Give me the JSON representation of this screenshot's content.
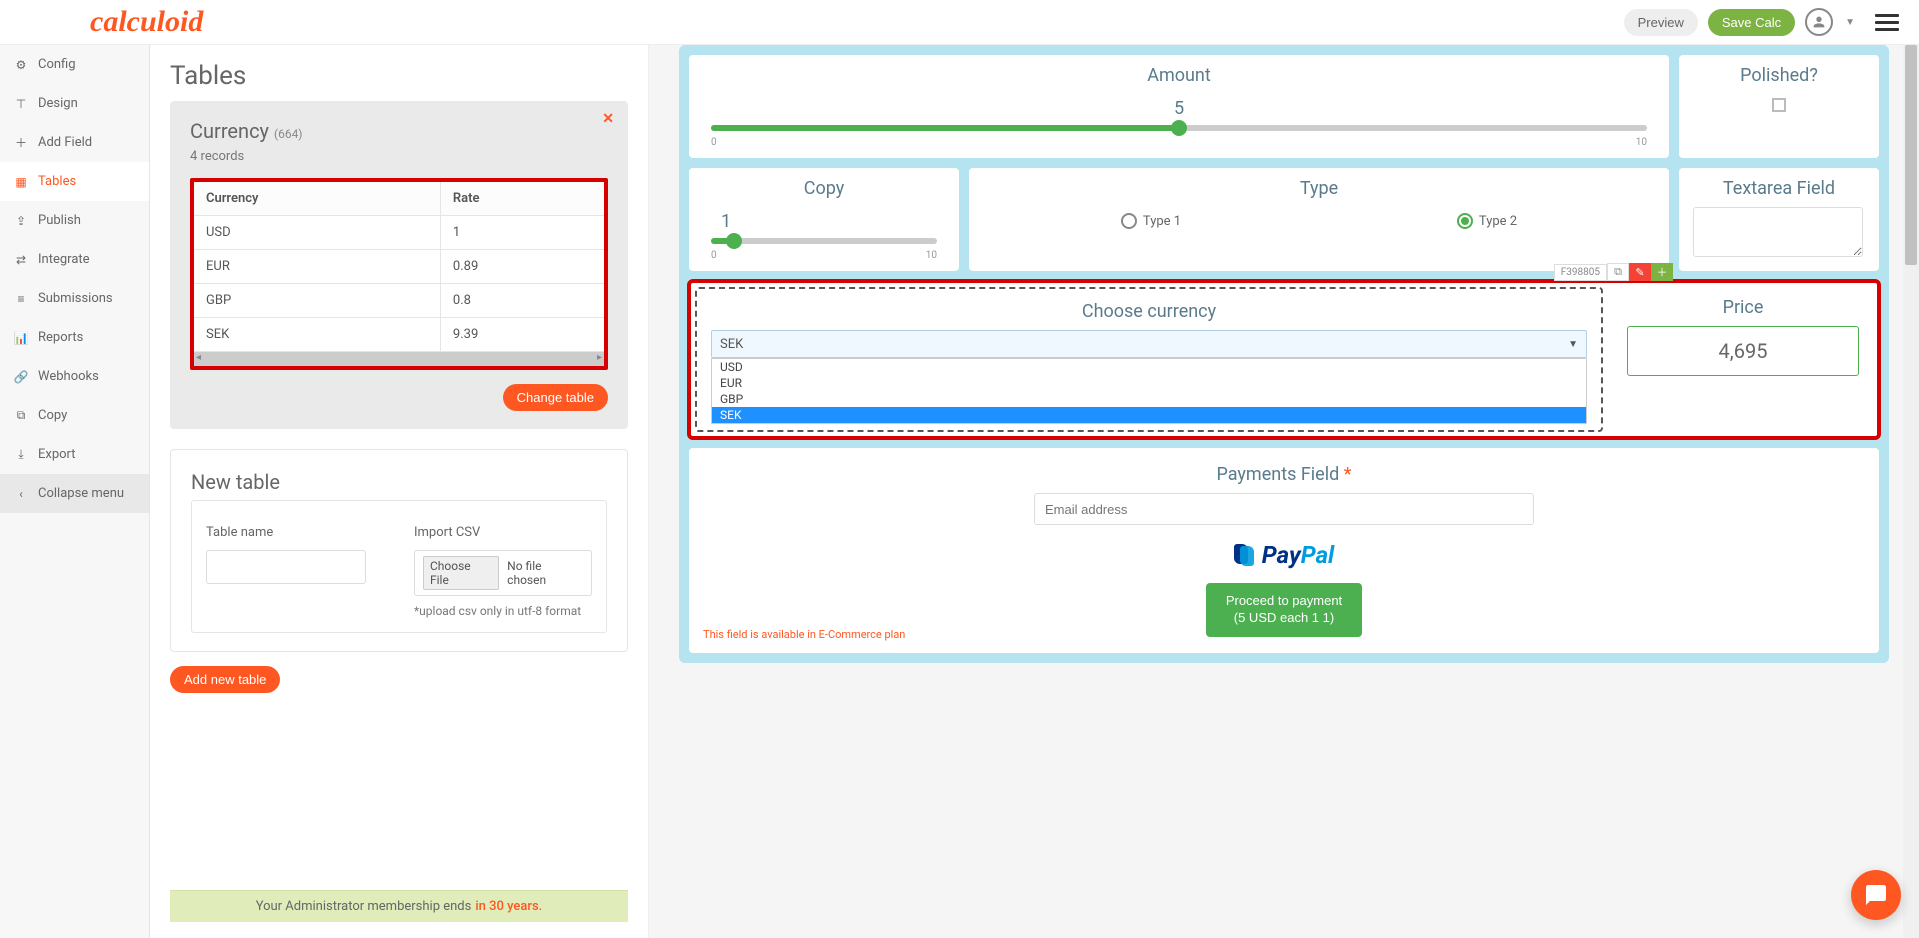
{
  "logo": "calculoid",
  "topbar": {
    "preview": "Preview",
    "save": "Save Calc"
  },
  "sidebar": {
    "items": [
      {
        "label": "Config",
        "icon": "⚙"
      },
      {
        "label": "Design",
        "icon": "⊤"
      },
      {
        "label": "Add Field",
        "icon": "＋"
      },
      {
        "label": "Tables",
        "icon": "▦",
        "active": true
      },
      {
        "label": "Publish",
        "icon": "⇪"
      },
      {
        "label": "Integrate",
        "icon": "⇄"
      },
      {
        "label": "Submissions",
        "icon": "≡"
      },
      {
        "label": "Reports",
        "icon": "📊"
      },
      {
        "label": "Webhooks",
        "icon": "🔗"
      },
      {
        "label": "Copy",
        "icon": "⧉"
      },
      {
        "label": "Export",
        "icon": "⤓"
      }
    ],
    "collapse": "Collapse menu"
  },
  "tables": {
    "title": "Tables",
    "currency_name": "Currency",
    "currency_id": "(664)",
    "record_count": "4 records",
    "headers": [
      "Currency",
      "Rate"
    ],
    "rows": [
      [
        "USD",
        "1"
      ],
      [
        "EUR",
        "0.89"
      ],
      [
        "GBP",
        "0.8"
      ],
      [
        "SEK",
        "9.39"
      ]
    ],
    "change_table": "Change table",
    "new_table_title": "New table",
    "table_name_label": "Table name",
    "import_csv_label": "Import CSV",
    "choose_file": "Choose File",
    "no_file": "No file chosen",
    "upload_hint": "*upload csv only in utf-8 format",
    "add_new": "Add new table"
  },
  "footer": {
    "text": "Your Administrator membership ends",
    "highlight": "in 30 years."
  },
  "canvas": {
    "amount": {
      "title": "Amount",
      "value": "5",
      "min": "0",
      "max": "10"
    },
    "polished": {
      "title": "Polished?"
    },
    "copy": {
      "title": "Copy",
      "value": "1",
      "min": "0",
      "max": "10"
    },
    "type": {
      "title": "Type",
      "options": [
        "Type 1",
        "Type 2"
      ],
      "selected": 1
    },
    "textarea": {
      "title": "Textarea Field"
    },
    "field_id": "F398805",
    "currency": {
      "title": "Choose currency",
      "selected": "SEK",
      "options": [
        "USD",
        "EUR",
        "GBP",
        "SEK"
      ],
      "selected_index": 3
    },
    "price": {
      "title": "Price",
      "value": "4,695"
    },
    "payments": {
      "title": "Payments Field",
      "email_placeholder": "Email address",
      "proceed_line1": "Proceed to payment",
      "proceed_line2": "(5 USD each 1 1)",
      "note": "This field is available in E-Commerce plan"
    }
  }
}
